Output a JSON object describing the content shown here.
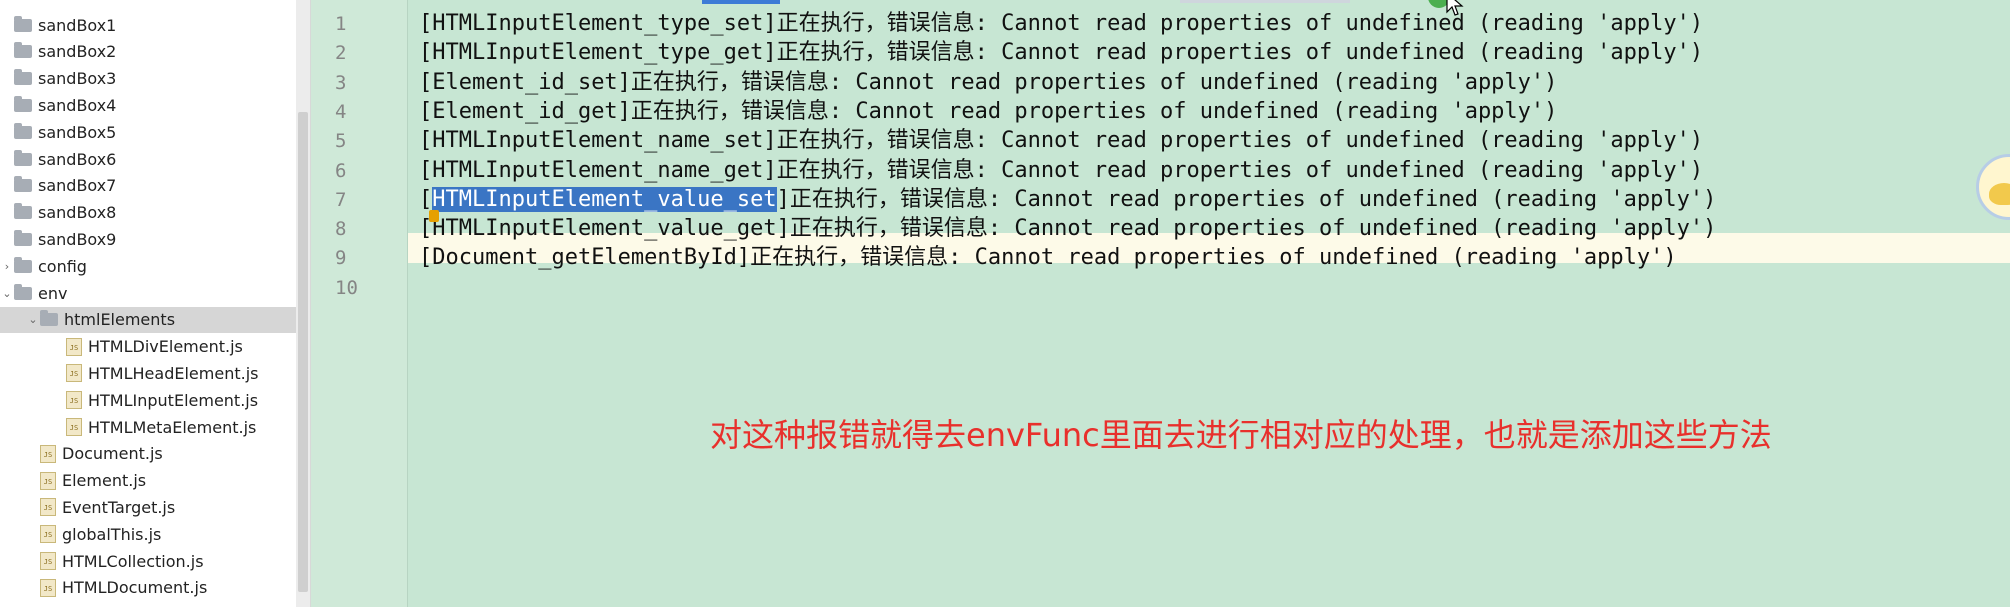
{
  "sidebar": {
    "items": [
      {
        "label": "sandBox1",
        "type": "folder",
        "level": 0,
        "expanded": null
      },
      {
        "label": "sandBox2",
        "type": "folder",
        "level": 0,
        "expanded": null
      },
      {
        "label": "sandBox3",
        "type": "folder",
        "level": 0,
        "expanded": null
      },
      {
        "label": "sandBox4",
        "type": "folder",
        "level": 0,
        "expanded": null
      },
      {
        "label": "sandBox5",
        "type": "folder",
        "level": 0,
        "expanded": null
      },
      {
        "label": "sandBox6",
        "type": "folder",
        "level": 0,
        "expanded": null
      },
      {
        "label": "sandBox7",
        "type": "folder",
        "level": 0,
        "expanded": null
      },
      {
        "label": "sandBox8",
        "type": "folder",
        "level": 0,
        "expanded": null
      },
      {
        "label": "sandBox9",
        "type": "folder",
        "level": 0,
        "expanded": null
      },
      {
        "label": "config",
        "type": "folder",
        "level": 0,
        "expanded": false
      },
      {
        "label": "env",
        "type": "folder",
        "level": 0,
        "expanded": true
      },
      {
        "label": "htmlElements",
        "type": "folder",
        "level": 1,
        "expanded": true,
        "selected": true
      },
      {
        "label": "HTMLDivElement.js",
        "type": "js",
        "level": 2
      },
      {
        "label": "HTMLHeadElement.js",
        "type": "js",
        "level": 2
      },
      {
        "label": "HTMLInputElement.js",
        "type": "js",
        "level": 2
      },
      {
        "label": "HTMLMetaElement.js",
        "type": "js",
        "level": 2
      },
      {
        "label": "Document.js",
        "type": "js",
        "level": 1
      },
      {
        "label": "Element.js",
        "type": "js",
        "level": 1
      },
      {
        "label": "EventTarget.js",
        "type": "js",
        "level": 1
      },
      {
        "label": "globalThis.js",
        "type": "js",
        "level": 1
      },
      {
        "label": "HTMLCollection.js",
        "type": "js",
        "level": 1
      },
      {
        "label": "HTMLDocument.js",
        "type": "js",
        "level": 1
      }
    ]
  },
  "editor": {
    "current_line": 7,
    "lines": [
      {
        "num": "1",
        "prefix": "[",
        "selected": "",
        "text": "HTMLInputElement_type_set]正在执行，错误信息: Cannot read properties of undefined (reading 'apply')"
      },
      {
        "num": "2",
        "prefix": "[",
        "selected": "",
        "text": "HTMLInputElement_type_get]正在执行，错误信息: Cannot read properties of undefined (reading 'apply')"
      },
      {
        "num": "3",
        "prefix": "[",
        "selected": "",
        "text": "Element_id_set]正在执行，错误信息: Cannot read properties of undefined (reading 'apply')"
      },
      {
        "num": "4",
        "prefix": "[",
        "selected": "",
        "text": "Element_id_get]正在执行，错误信息: Cannot read properties of undefined (reading 'apply')"
      },
      {
        "num": "5",
        "prefix": "[",
        "selected": "",
        "text": "HTMLInputElement_name_set]正在执行，错误信息: Cannot read properties of undefined (reading 'apply')"
      },
      {
        "num": "6",
        "prefix": "[",
        "selected": "",
        "text": "HTMLInputElement_name_get]正在执行，错误信息: Cannot read properties of undefined (reading 'apply')"
      },
      {
        "num": "7",
        "prefix": "[",
        "selected": "HTMLInputElement_value_set",
        "text": "]正在执行，错误信息: Cannot read properties of undefined (reading 'apply')"
      },
      {
        "num": "8",
        "prefix": "[",
        "selected": "",
        "text": "HTMLInputElement_value_get]正在执行，错误信息: Cannot read properties of undefined (reading 'apply')"
      },
      {
        "num": "9",
        "prefix": "[",
        "selected": "",
        "text": "Document_getElementById]正在执行，错误信息: Cannot read properties of undefined (reading 'apply')"
      },
      {
        "num": "10",
        "prefix": "",
        "selected": "",
        "text": ""
      }
    ]
  },
  "caption": "对这种报错就得去envFunc里面去进行相对应的处理，也就是添加这些方法",
  "colors": {
    "editor_bg": "#c7e6d3",
    "selection": "#3a75c4",
    "current_line": "#fdfae8",
    "caption": "#e8302c",
    "sidebar_selected": "#d6d6d6"
  }
}
